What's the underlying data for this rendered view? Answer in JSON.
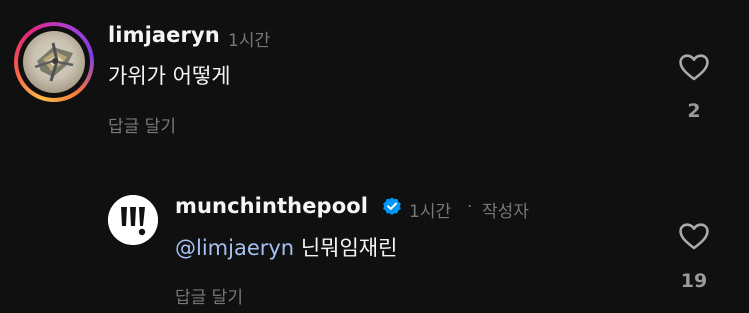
{
  "comments": [
    {
      "username": "limjaeryn",
      "time": "1시간",
      "text": "가위가 어떻게",
      "reply_label": "답글 달기",
      "like_count": "2",
      "icons": {
        "like": "heart-outline-icon",
        "avatar_ring": "story-ring"
      }
    },
    {
      "username": "munchinthepool",
      "time": "1시간",
      "separator": "·",
      "author_label": "작성자",
      "mention": "@limjaeryn",
      "text": "닌뭐임재린",
      "reply_label": "답글 달기",
      "like_count": "19",
      "icons": {
        "like": "heart-outline-icon",
        "verified": "verified-badge-icon"
      }
    }
  ],
  "colors": {
    "background": "#101010",
    "primary_text": "#f3f5f7",
    "secondary_text": "#777777",
    "mention": "#a4c2f4",
    "verified": "#0095f6"
  }
}
